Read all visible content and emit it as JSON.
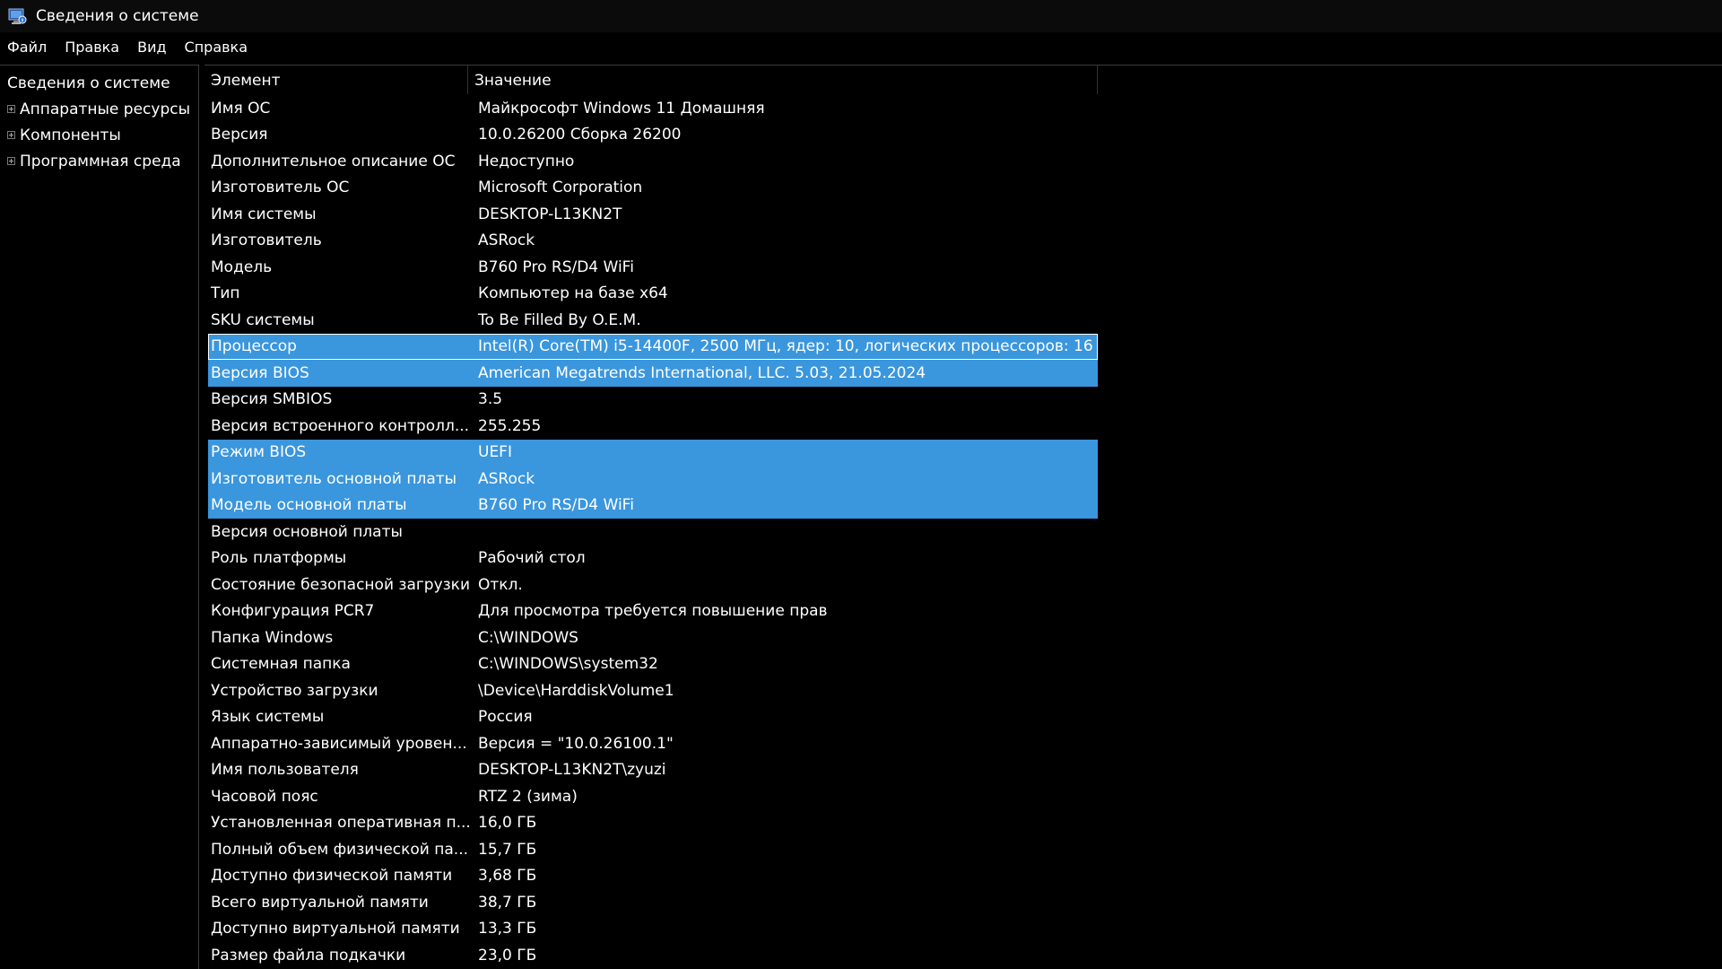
{
  "window": {
    "title": "Сведения о системе",
    "icon": "system-info-icon"
  },
  "menu": [
    "Файл",
    "Правка",
    "Вид",
    "Справка"
  ],
  "tree": {
    "root": "Сведения о системе",
    "items": [
      "Аппаратные ресурсы",
      "Компоненты",
      "Программная среда"
    ]
  },
  "columns": {
    "element": "Элемент",
    "value": "Значение"
  },
  "colors": {
    "selection": "#3a96dd",
    "background": "#000000",
    "text": "#ffffff"
  },
  "rows": [
    {
      "name": "Имя ОС",
      "value": "Майкрософт Windows 11 Домашняя",
      "selected": false
    },
    {
      "name": "Версия",
      "value": "10.0.26200 Сборка 26200",
      "selected": false
    },
    {
      "name": "Дополнительное описание ОС",
      "value": "Недоступно",
      "selected": false
    },
    {
      "name": "Изготовитель ОС",
      "value": "Microsoft Corporation",
      "selected": false
    },
    {
      "name": "Имя системы",
      "value": "DESKTOP-L13KN2T",
      "selected": false
    },
    {
      "name": "Изготовитель",
      "value": "ASRock",
      "selected": false
    },
    {
      "name": "Модель",
      "value": "B760 Pro RS/D4 WiFi",
      "selected": false
    },
    {
      "name": "Тип",
      "value": "Компьютер на базе x64",
      "selected": false
    },
    {
      "name": "SKU системы",
      "value": "To Be Filled By O.E.M.",
      "selected": false
    },
    {
      "name": "Процессор",
      "value": "Intel(R) Core(TM) i5-14400F, 2500 МГц, ядер: 10, логических процессоров: 16",
      "selected": true,
      "focused": true
    },
    {
      "name": "Версия BIOS",
      "value": "American Megatrends International, LLC. 5.03, 21.05.2024",
      "selected": true
    },
    {
      "name": "Версия SMBIOS",
      "value": "3.5",
      "selected": false
    },
    {
      "name": "Версия встроенного контролл...",
      "value": "255.255",
      "selected": false
    },
    {
      "name": "Режим BIOS",
      "value": "UEFI",
      "selected": true
    },
    {
      "name": "Изготовитель основной платы",
      "value": "ASRock",
      "selected": true
    },
    {
      "name": "Модель основной платы",
      "value": "B760 Pro RS/D4 WiFi",
      "selected": true
    },
    {
      "name": "Версия основной платы",
      "value": "",
      "selected": false
    },
    {
      "name": "Роль платформы",
      "value": "Рабочий стол",
      "selected": false
    },
    {
      "name": "Состояние безопасной загрузки",
      "value": "Откл.",
      "selected": false
    },
    {
      "name": "Конфигурация PCR7",
      "value": "Для просмотра требуется повышение прав",
      "selected": false
    },
    {
      "name": "Папка Windows",
      "value": "C:\\WINDOWS",
      "selected": false
    },
    {
      "name": "Системная папка",
      "value": "C:\\WINDOWS\\system32",
      "selected": false
    },
    {
      "name": "Устройство загрузки",
      "value": "\\Device\\HarddiskVolume1",
      "selected": false
    },
    {
      "name": "Язык системы",
      "value": "Россия",
      "selected": false
    },
    {
      "name": "Аппаратно-зависимый уровен...",
      "value": "Версия = \"10.0.26100.1\"",
      "selected": false
    },
    {
      "name": "Имя пользователя",
      "value": "DESKTOP-L13KN2T\\zyuzi",
      "selected": false
    },
    {
      "name": "Часовой пояс",
      "value": "RTZ 2 (зима)",
      "selected": false
    },
    {
      "name": "Установленная оперативная п...",
      "value": "16,0 ГБ",
      "selected": false
    },
    {
      "name": "Полный объем физической па...",
      "value": "15,7 ГБ",
      "selected": false
    },
    {
      "name": "Доступно физической памяти",
      "value": "3,68 ГБ",
      "selected": false
    },
    {
      "name": "Всего виртуальной памяти",
      "value": "38,7 ГБ",
      "selected": false
    },
    {
      "name": "Доступно виртуальной памяти",
      "value": "13,3 ГБ",
      "selected": false
    },
    {
      "name": "Размер файла подкачки",
      "value": "23,0 ГБ",
      "selected": false
    }
  ]
}
